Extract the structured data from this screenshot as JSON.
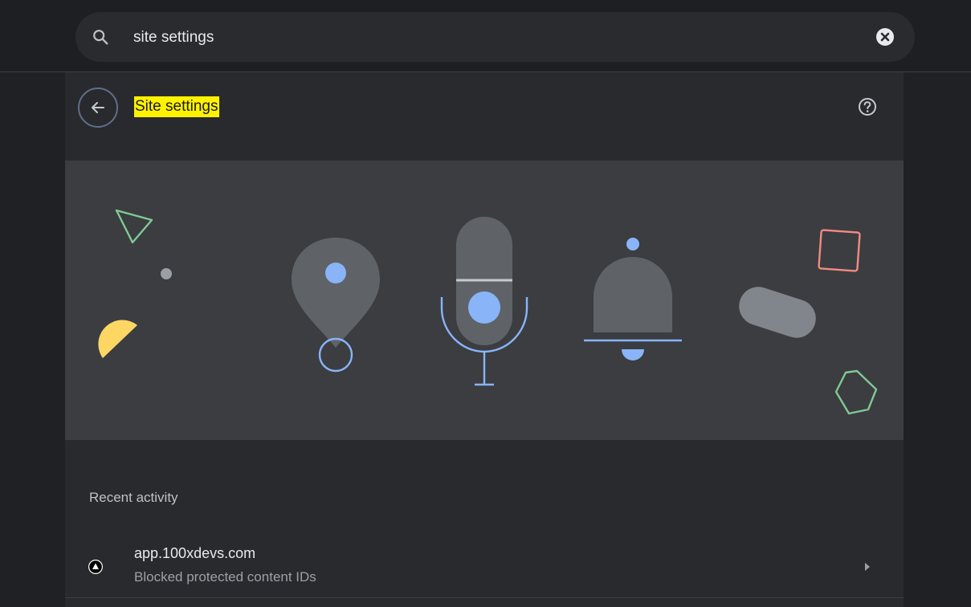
{
  "search": {
    "value": "site settings",
    "icon": "search-icon",
    "clear_icon": "clear-icon"
  },
  "header": {
    "back_icon": "arrow-back-icon",
    "title": "Site settings",
    "title_highlight": "#fff200",
    "help_icon": "help-icon"
  },
  "banner": {
    "illustration": [
      "location-pin-icon",
      "microphone-icon",
      "bell-icon"
    ],
    "colors": {
      "blue": "#8ab4f8",
      "gray": "#5f6368",
      "green": "#81c995",
      "red": "#f28b82",
      "yellow": "#fdd663"
    }
  },
  "recent_activity": {
    "title": "Recent activity",
    "items": [
      {
        "site": "app.100xdevs.com",
        "status": "Blocked protected content IDs",
        "icon": "site-favicon"
      }
    ]
  },
  "colors": {
    "background": "#202124",
    "panel": "#292a2d",
    "search_bg": "#2a2b2e"
  }
}
